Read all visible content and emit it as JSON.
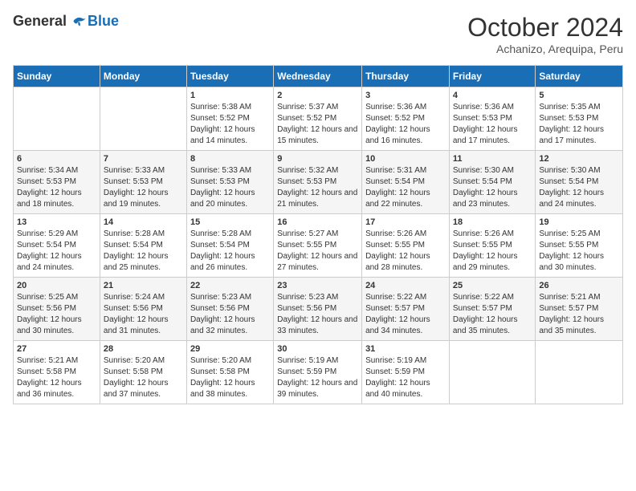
{
  "logo": {
    "general": "General",
    "blue": "Blue"
  },
  "title": "October 2024",
  "location": "Achanizo, Arequipa, Peru",
  "days_of_week": [
    "Sunday",
    "Monday",
    "Tuesday",
    "Wednesday",
    "Thursday",
    "Friday",
    "Saturday"
  ],
  "weeks": [
    [
      {
        "day": "",
        "sunrise": "",
        "sunset": "",
        "daylight": ""
      },
      {
        "day": "",
        "sunrise": "",
        "sunset": "",
        "daylight": ""
      },
      {
        "day": "1",
        "sunrise": "Sunrise: 5:38 AM",
        "sunset": "Sunset: 5:52 PM",
        "daylight": "Daylight: 12 hours and 14 minutes."
      },
      {
        "day": "2",
        "sunrise": "Sunrise: 5:37 AM",
        "sunset": "Sunset: 5:52 PM",
        "daylight": "Daylight: 12 hours and 15 minutes."
      },
      {
        "day": "3",
        "sunrise": "Sunrise: 5:36 AM",
        "sunset": "Sunset: 5:52 PM",
        "daylight": "Daylight: 12 hours and 16 minutes."
      },
      {
        "day": "4",
        "sunrise": "Sunrise: 5:36 AM",
        "sunset": "Sunset: 5:53 PM",
        "daylight": "Daylight: 12 hours and 17 minutes."
      },
      {
        "day": "5",
        "sunrise": "Sunrise: 5:35 AM",
        "sunset": "Sunset: 5:53 PM",
        "daylight": "Daylight: 12 hours and 17 minutes."
      }
    ],
    [
      {
        "day": "6",
        "sunrise": "Sunrise: 5:34 AM",
        "sunset": "Sunset: 5:53 PM",
        "daylight": "Daylight: 12 hours and 18 minutes."
      },
      {
        "day": "7",
        "sunrise": "Sunrise: 5:33 AM",
        "sunset": "Sunset: 5:53 PM",
        "daylight": "Daylight: 12 hours and 19 minutes."
      },
      {
        "day": "8",
        "sunrise": "Sunrise: 5:33 AM",
        "sunset": "Sunset: 5:53 PM",
        "daylight": "Daylight: 12 hours and 20 minutes."
      },
      {
        "day": "9",
        "sunrise": "Sunrise: 5:32 AM",
        "sunset": "Sunset: 5:53 PM",
        "daylight": "Daylight: 12 hours and 21 minutes."
      },
      {
        "day": "10",
        "sunrise": "Sunrise: 5:31 AM",
        "sunset": "Sunset: 5:54 PM",
        "daylight": "Daylight: 12 hours and 22 minutes."
      },
      {
        "day": "11",
        "sunrise": "Sunrise: 5:30 AM",
        "sunset": "Sunset: 5:54 PM",
        "daylight": "Daylight: 12 hours and 23 minutes."
      },
      {
        "day": "12",
        "sunrise": "Sunrise: 5:30 AM",
        "sunset": "Sunset: 5:54 PM",
        "daylight": "Daylight: 12 hours and 24 minutes."
      }
    ],
    [
      {
        "day": "13",
        "sunrise": "Sunrise: 5:29 AM",
        "sunset": "Sunset: 5:54 PM",
        "daylight": "Daylight: 12 hours and 24 minutes."
      },
      {
        "day": "14",
        "sunrise": "Sunrise: 5:28 AM",
        "sunset": "Sunset: 5:54 PM",
        "daylight": "Daylight: 12 hours and 25 minutes."
      },
      {
        "day": "15",
        "sunrise": "Sunrise: 5:28 AM",
        "sunset": "Sunset: 5:54 PM",
        "daylight": "Daylight: 12 hours and 26 minutes."
      },
      {
        "day": "16",
        "sunrise": "Sunrise: 5:27 AM",
        "sunset": "Sunset: 5:55 PM",
        "daylight": "Daylight: 12 hours and 27 minutes."
      },
      {
        "day": "17",
        "sunrise": "Sunrise: 5:26 AM",
        "sunset": "Sunset: 5:55 PM",
        "daylight": "Daylight: 12 hours and 28 minutes."
      },
      {
        "day": "18",
        "sunrise": "Sunrise: 5:26 AM",
        "sunset": "Sunset: 5:55 PM",
        "daylight": "Daylight: 12 hours and 29 minutes."
      },
      {
        "day": "19",
        "sunrise": "Sunrise: 5:25 AM",
        "sunset": "Sunset: 5:55 PM",
        "daylight": "Daylight: 12 hours and 30 minutes."
      }
    ],
    [
      {
        "day": "20",
        "sunrise": "Sunrise: 5:25 AM",
        "sunset": "Sunset: 5:56 PM",
        "daylight": "Daylight: 12 hours and 30 minutes."
      },
      {
        "day": "21",
        "sunrise": "Sunrise: 5:24 AM",
        "sunset": "Sunset: 5:56 PM",
        "daylight": "Daylight: 12 hours and 31 minutes."
      },
      {
        "day": "22",
        "sunrise": "Sunrise: 5:23 AM",
        "sunset": "Sunset: 5:56 PM",
        "daylight": "Daylight: 12 hours and 32 minutes."
      },
      {
        "day": "23",
        "sunrise": "Sunrise: 5:23 AM",
        "sunset": "Sunset: 5:56 PM",
        "daylight": "Daylight: 12 hours and 33 minutes."
      },
      {
        "day": "24",
        "sunrise": "Sunrise: 5:22 AM",
        "sunset": "Sunset: 5:57 PM",
        "daylight": "Daylight: 12 hours and 34 minutes."
      },
      {
        "day": "25",
        "sunrise": "Sunrise: 5:22 AM",
        "sunset": "Sunset: 5:57 PM",
        "daylight": "Daylight: 12 hours and 35 minutes."
      },
      {
        "day": "26",
        "sunrise": "Sunrise: 5:21 AM",
        "sunset": "Sunset: 5:57 PM",
        "daylight": "Daylight: 12 hours and 35 minutes."
      }
    ],
    [
      {
        "day": "27",
        "sunrise": "Sunrise: 5:21 AM",
        "sunset": "Sunset: 5:58 PM",
        "daylight": "Daylight: 12 hours and 36 minutes."
      },
      {
        "day": "28",
        "sunrise": "Sunrise: 5:20 AM",
        "sunset": "Sunset: 5:58 PM",
        "daylight": "Daylight: 12 hours and 37 minutes."
      },
      {
        "day": "29",
        "sunrise": "Sunrise: 5:20 AM",
        "sunset": "Sunset: 5:58 PM",
        "daylight": "Daylight: 12 hours and 38 minutes."
      },
      {
        "day": "30",
        "sunrise": "Sunrise: 5:19 AM",
        "sunset": "Sunset: 5:59 PM",
        "daylight": "Daylight: 12 hours and 39 minutes."
      },
      {
        "day": "31",
        "sunrise": "Sunrise: 5:19 AM",
        "sunset": "Sunset: 5:59 PM",
        "daylight": "Daylight: 12 hours and 40 minutes."
      },
      {
        "day": "",
        "sunrise": "",
        "sunset": "",
        "daylight": ""
      },
      {
        "day": "",
        "sunrise": "",
        "sunset": "",
        "daylight": ""
      }
    ]
  ]
}
